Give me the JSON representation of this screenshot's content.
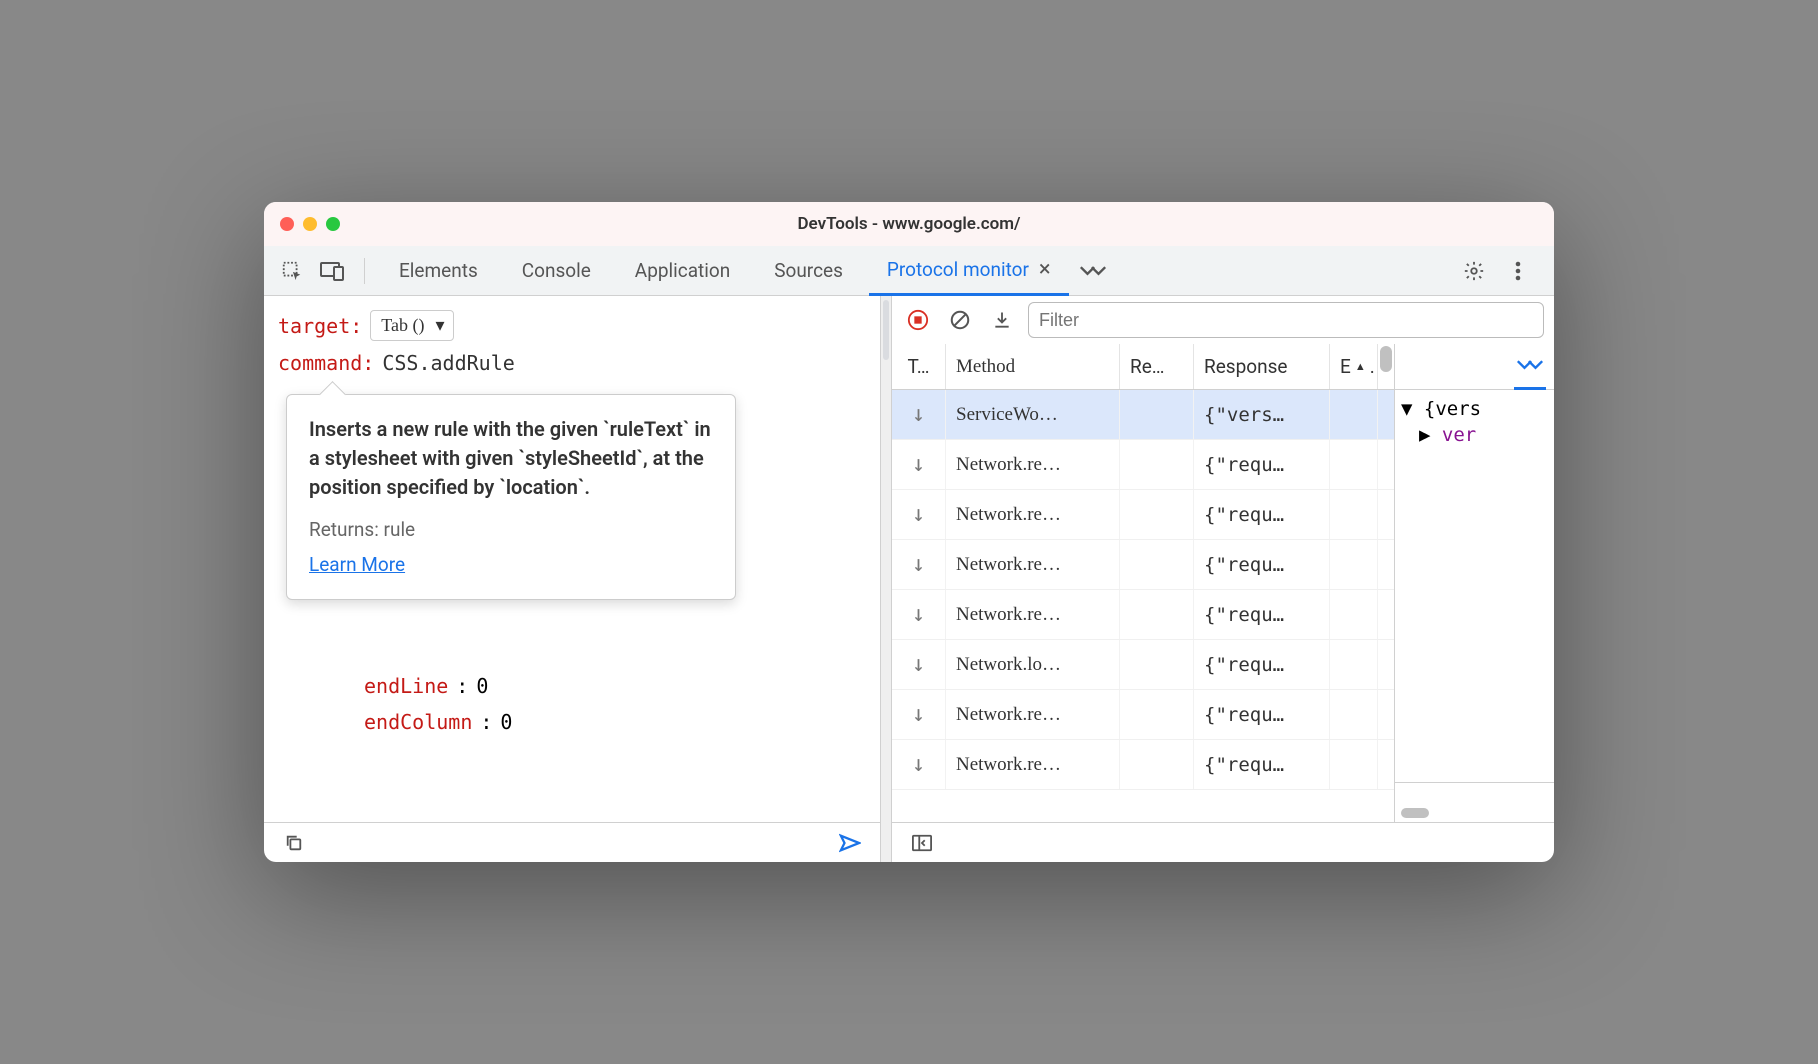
{
  "window": {
    "title": "DevTools - www.google.com/"
  },
  "tabs": {
    "items": [
      "Elements",
      "Console",
      "Application",
      "Sources",
      "Protocol monitor"
    ],
    "active": 4
  },
  "editor": {
    "target_label": "target",
    "target_select": "Tab ()",
    "command_label": "command",
    "command_value": "CSS.addRule",
    "tooltip": {
      "description": "Inserts a new rule with the given `ruleText` in a stylesheet with given `styleSheetId`, at the position specified by `location`.",
      "returns": "Returns: rule",
      "link": "Learn More"
    },
    "visible_params": [
      {
        "key": "endLine",
        "value": "0"
      },
      {
        "key": "endColumn",
        "value": "0"
      }
    ]
  },
  "monitor": {
    "filter_placeholder": "Filter",
    "columns": {
      "t": "T…",
      "method": "Method",
      "re": "Re…",
      "response": "Response",
      "e": "E"
    },
    "rows": [
      {
        "direction": "down",
        "method": "ServiceWo…",
        "re": "",
        "response": "{\"vers…",
        "selected": true
      },
      {
        "direction": "down",
        "method": "Network.re…",
        "re": "",
        "response": "{\"requ…"
      },
      {
        "direction": "down",
        "method": "Network.re…",
        "re": "",
        "response": "{\"requ…"
      },
      {
        "direction": "down",
        "method": "Network.re…",
        "re": "",
        "response": "{\"requ…"
      },
      {
        "direction": "down",
        "method": "Network.re…",
        "re": "",
        "response": "{\"requ…"
      },
      {
        "direction": "down",
        "method": "Network.lo…",
        "re": "",
        "response": "{\"requ…"
      },
      {
        "direction": "down",
        "method": "Network.re…",
        "re": "",
        "response": "{\"requ…"
      },
      {
        "direction": "down",
        "method": "Network.re…",
        "re": "",
        "response": "{\"requ…"
      }
    ]
  },
  "details": {
    "root": "{vers",
    "child_key": "ver"
  }
}
